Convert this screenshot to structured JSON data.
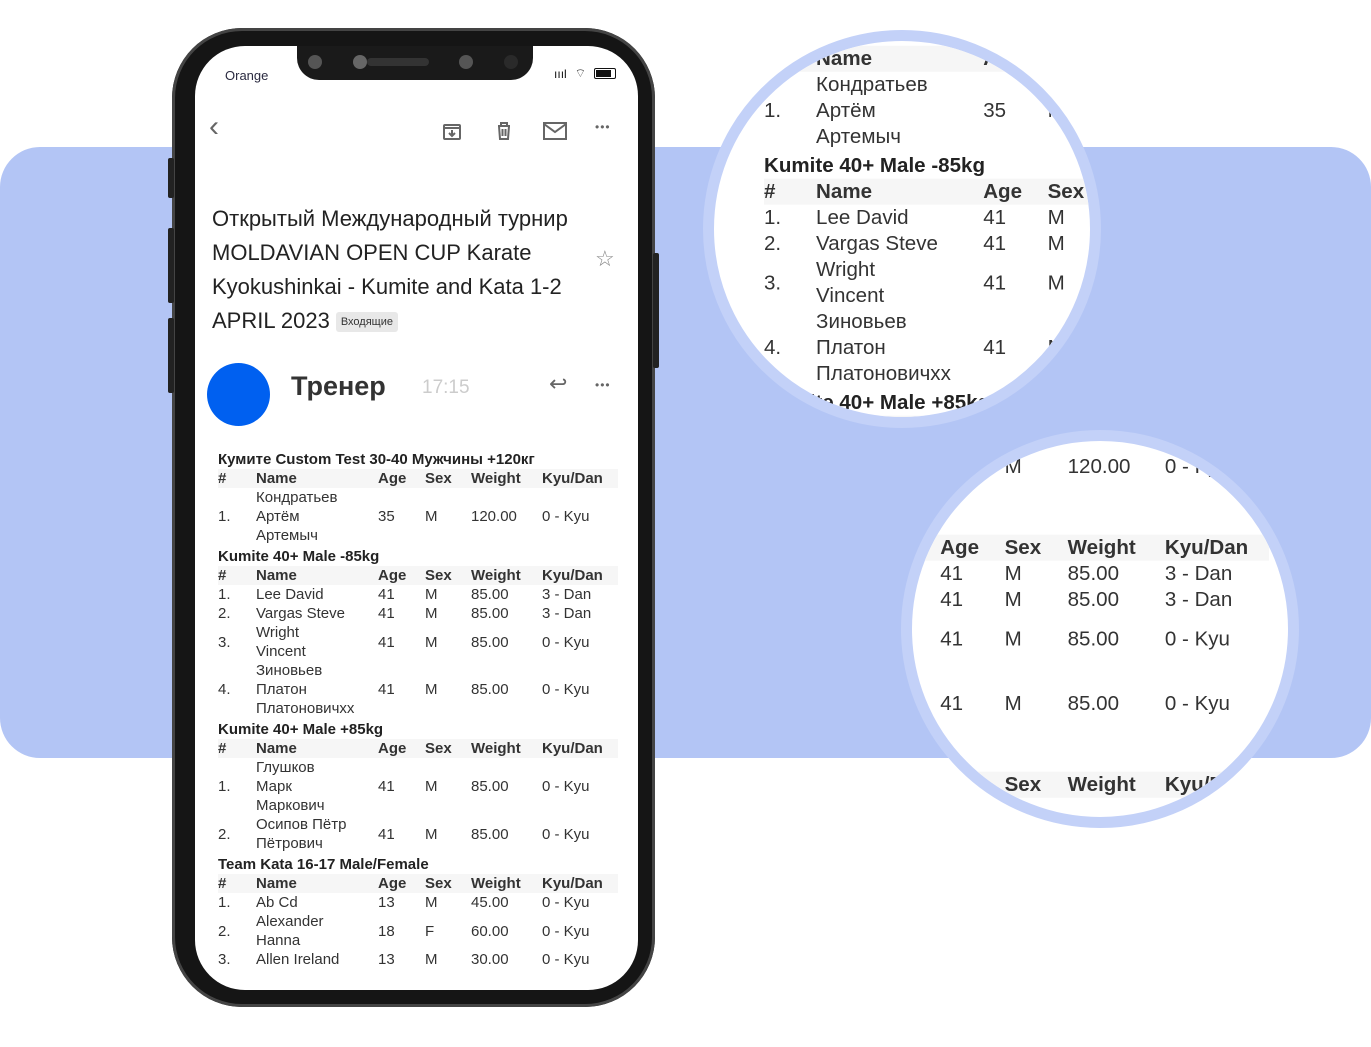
{
  "status": {
    "carrier": "Orange"
  },
  "toolbar": {
    "back": "‹",
    "archive": "archive-icon",
    "delete": "trash-icon",
    "mark": "mail-icon",
    "more": "•••"
  },
  "email": {
    "subject": "Открытый Международный турнир MOLDAVIAN OPEN CUP Karate Kyokushinkai - Kumite and Kata 1-2 APRIL 2023",
    "label": "Входящие",
    "sender": "Тренер",
    "time": "17:15",
    "avatar_color": "#0060f0"
  },
  "columns": [
    "#",
    "Name",
    "Age",
    "Sex",
    "Weight",
    "Kyu/Dan"
  ],
  "categories": [
    {
      "title": "Кумите Custom Test 30-40 Мужчины +120кг",
      "rows": [
        [
          "1.",
          [
            "Кондратьев",
            "Артём",
            "Артемыч"
          ],
          "35",
          "M",
          "120.00",
          "0 - Kyu"
        ]
      ]
    },
    {
      "title": "Kumite 40+ Male -85kg",
      "rows": [
        [
          "1.",
          [
            "Lee David"
          ],
          "41",
          "M",
          "85.00",
          "3 - Dan"
        ],
        [
          "2.",
          [
            "Vargas Steve"
          ],
          "41",
          "M",
          "85.00",
          "3 - Dan"
        ],
        [
          "3.",
          [
            "Wright",
            "Vincent"
          ],
          "41",
          "M",
          "85.00",
          "0 - Kyu"
        ],
        [
          "4.",
          [
            "Зиновьев",
            "Платон",
            "Платоновичхх"
          ],
          "41",
          "M",
          "85.00",
          "0 - Kyu"
        ]
      ]
    },
    {
      "title": "Kumite 40+ Male +85kg",
      "rows": [
        [
          "1.",
          [
            "Глушков",
            "Марк",
            "Маркович"
          ],
          "41",
          "M",
          "85.00",
          "0 - Kyu"
        ],
        [
          "2.",
          [
            "Осипов Пётр",
            "Пётрович"
          ],
          "41",
          "M",
          "85.00",
          "0 - Kyu"
        ]
      ]
    },
    {
      "title": "Team Kata 16-17 Male/Female",
      "rows": [
        [
          "1.",
          [
            "Ab Cd"
          ],
          "13",
          "M",
          "45.00",
          "0 - Kyu"
        ],
        [
          "2.",
          [
            "Alexander",
            "Hanna"
          ],
          "18",
          "F",
          "60.00",
          "0 - Kyu"
        ],
        [
          "3.",
          [
            "Allen Ireland"
          ],
          "13",
          "M",
          "30.00",
          "0 - Kyu"
        ]
      ]
    }
  ]
}
